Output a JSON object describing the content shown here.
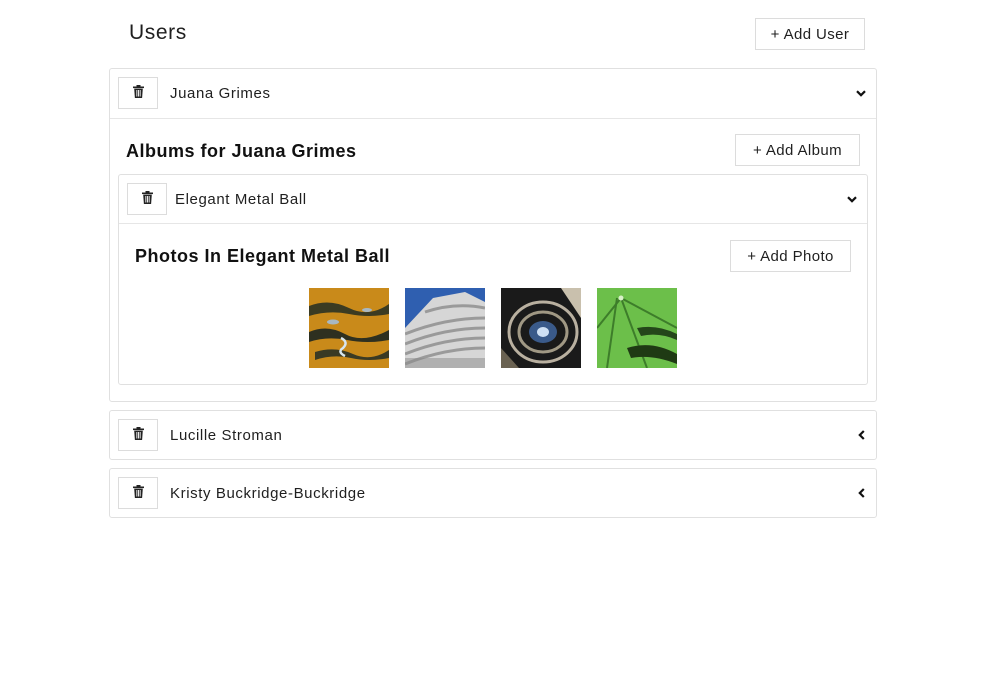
{
  "header": {
    "title": "Users",
    "add_user_label": "+ Add User"
  },
  "users": [
    {
      "name": "Juana Grimes",
      "expanded": true,
      "chevron": "chevron-down-icon",
      "albums_title": "Albums for Juana Grimes",
      "add_album_label": "+ Add Album",
      "albums": [
        {
          "name": "Elegant Metal Ball",
          "expanded": true,
          "chevron": "chevron-down-icon",
          "photos_title": "Photos In Elegant Metal Ball",
          "add_photo_label": "+ Add Photo",
          "photos": [
            {
              "subject": "orange water reflection"
            },
            {
              "subject": "curved white building facade"
            },
            {
              "subject": "spiral staircase from below"
            },
            {
              "subject": "green lotus leaf"
            }
          ]
        }
      ]
    },
    {
      "name": "Lucille Stroman",
      "expanded": false,
      "chevron": "chevron-left-icon"
    },
    {
      "name": "Kristy Buckridge-Buckridge",
      "expanded": false,
      "chevron": "chevron-left-icon"
    }
  ],
  "colors": {
    "border": "#e0e0e0",
    "text": "#1f1f1f"
  }
}
